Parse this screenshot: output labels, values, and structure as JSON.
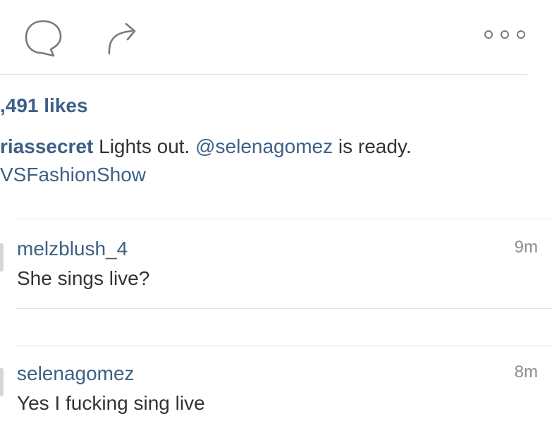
{
  "actions": {
    "comment_icon": "comment-bubble-icon",
    "share_icon": "share-arrow-icon",
    "more_icon": "more-dots-icon"
  },
  "post": {
    "likes": ",491 likes",
    "caption_user": "riassecret",
    "caption_text_1": " Lights out. ",
    "caption_mention": "@selenagomez",
    "caption_text_2": " is ready.",
    "caption_hashtag": "VSFashionShow"
  },
  "comments": [
    {
      "user": "melzblush_4",
      "text": "She sings live?",
      "time": "9m"
    },
    {
      "user": "selenagomez",
      "text": "Yes I fucking sing live",
      "time": "8m"
    }
  ],
  "colors": {
    "link": "#3c6186",
    "text": "#333333",
    "muted": "#8e8e8e",
    "icon": "#7a7a7a"
  }
}
